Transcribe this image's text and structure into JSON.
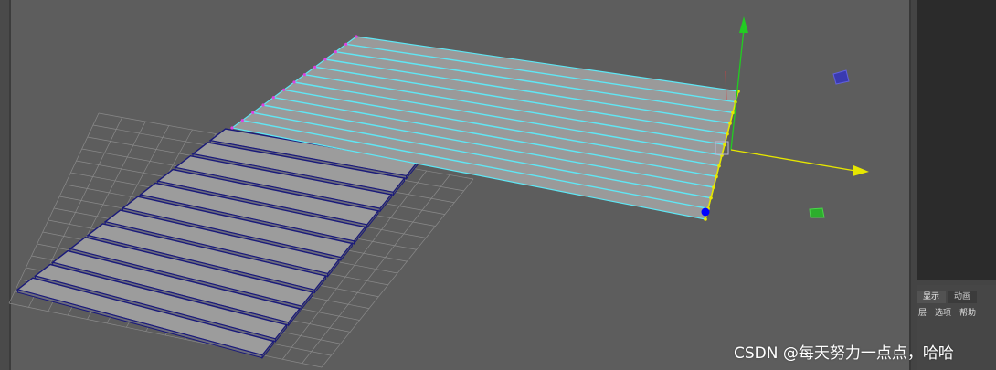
{
  "viewport": {
    "background": "#5d5d5d",
    "grid_color": "#8a8a8a",
    "plank_count_original": 12,
    "plank_count_selected": 12,
    "plank_fill": "#9c9c9c",
    "plank_edge_color": "#1a1a7a",
    "selection_color": "#5fe7f5",
    "manipulator": {
      "y_axis_color": "#22cc22",
      "x_axis_color": "#e6e600",
      "z_axis_color": "#2020ff",
      "pivot_color": "#0000ff"
    }
  },
  "channel_box": {
    "tabs": [
      "显示",
      "动画"
    ],
    "active_tab": "显示",
    "menu": [
      "层",
      "选项",
      "帮助"
    ]
  },
  "watermark": "CSDN @每天努力一点点，哈哈"
}
